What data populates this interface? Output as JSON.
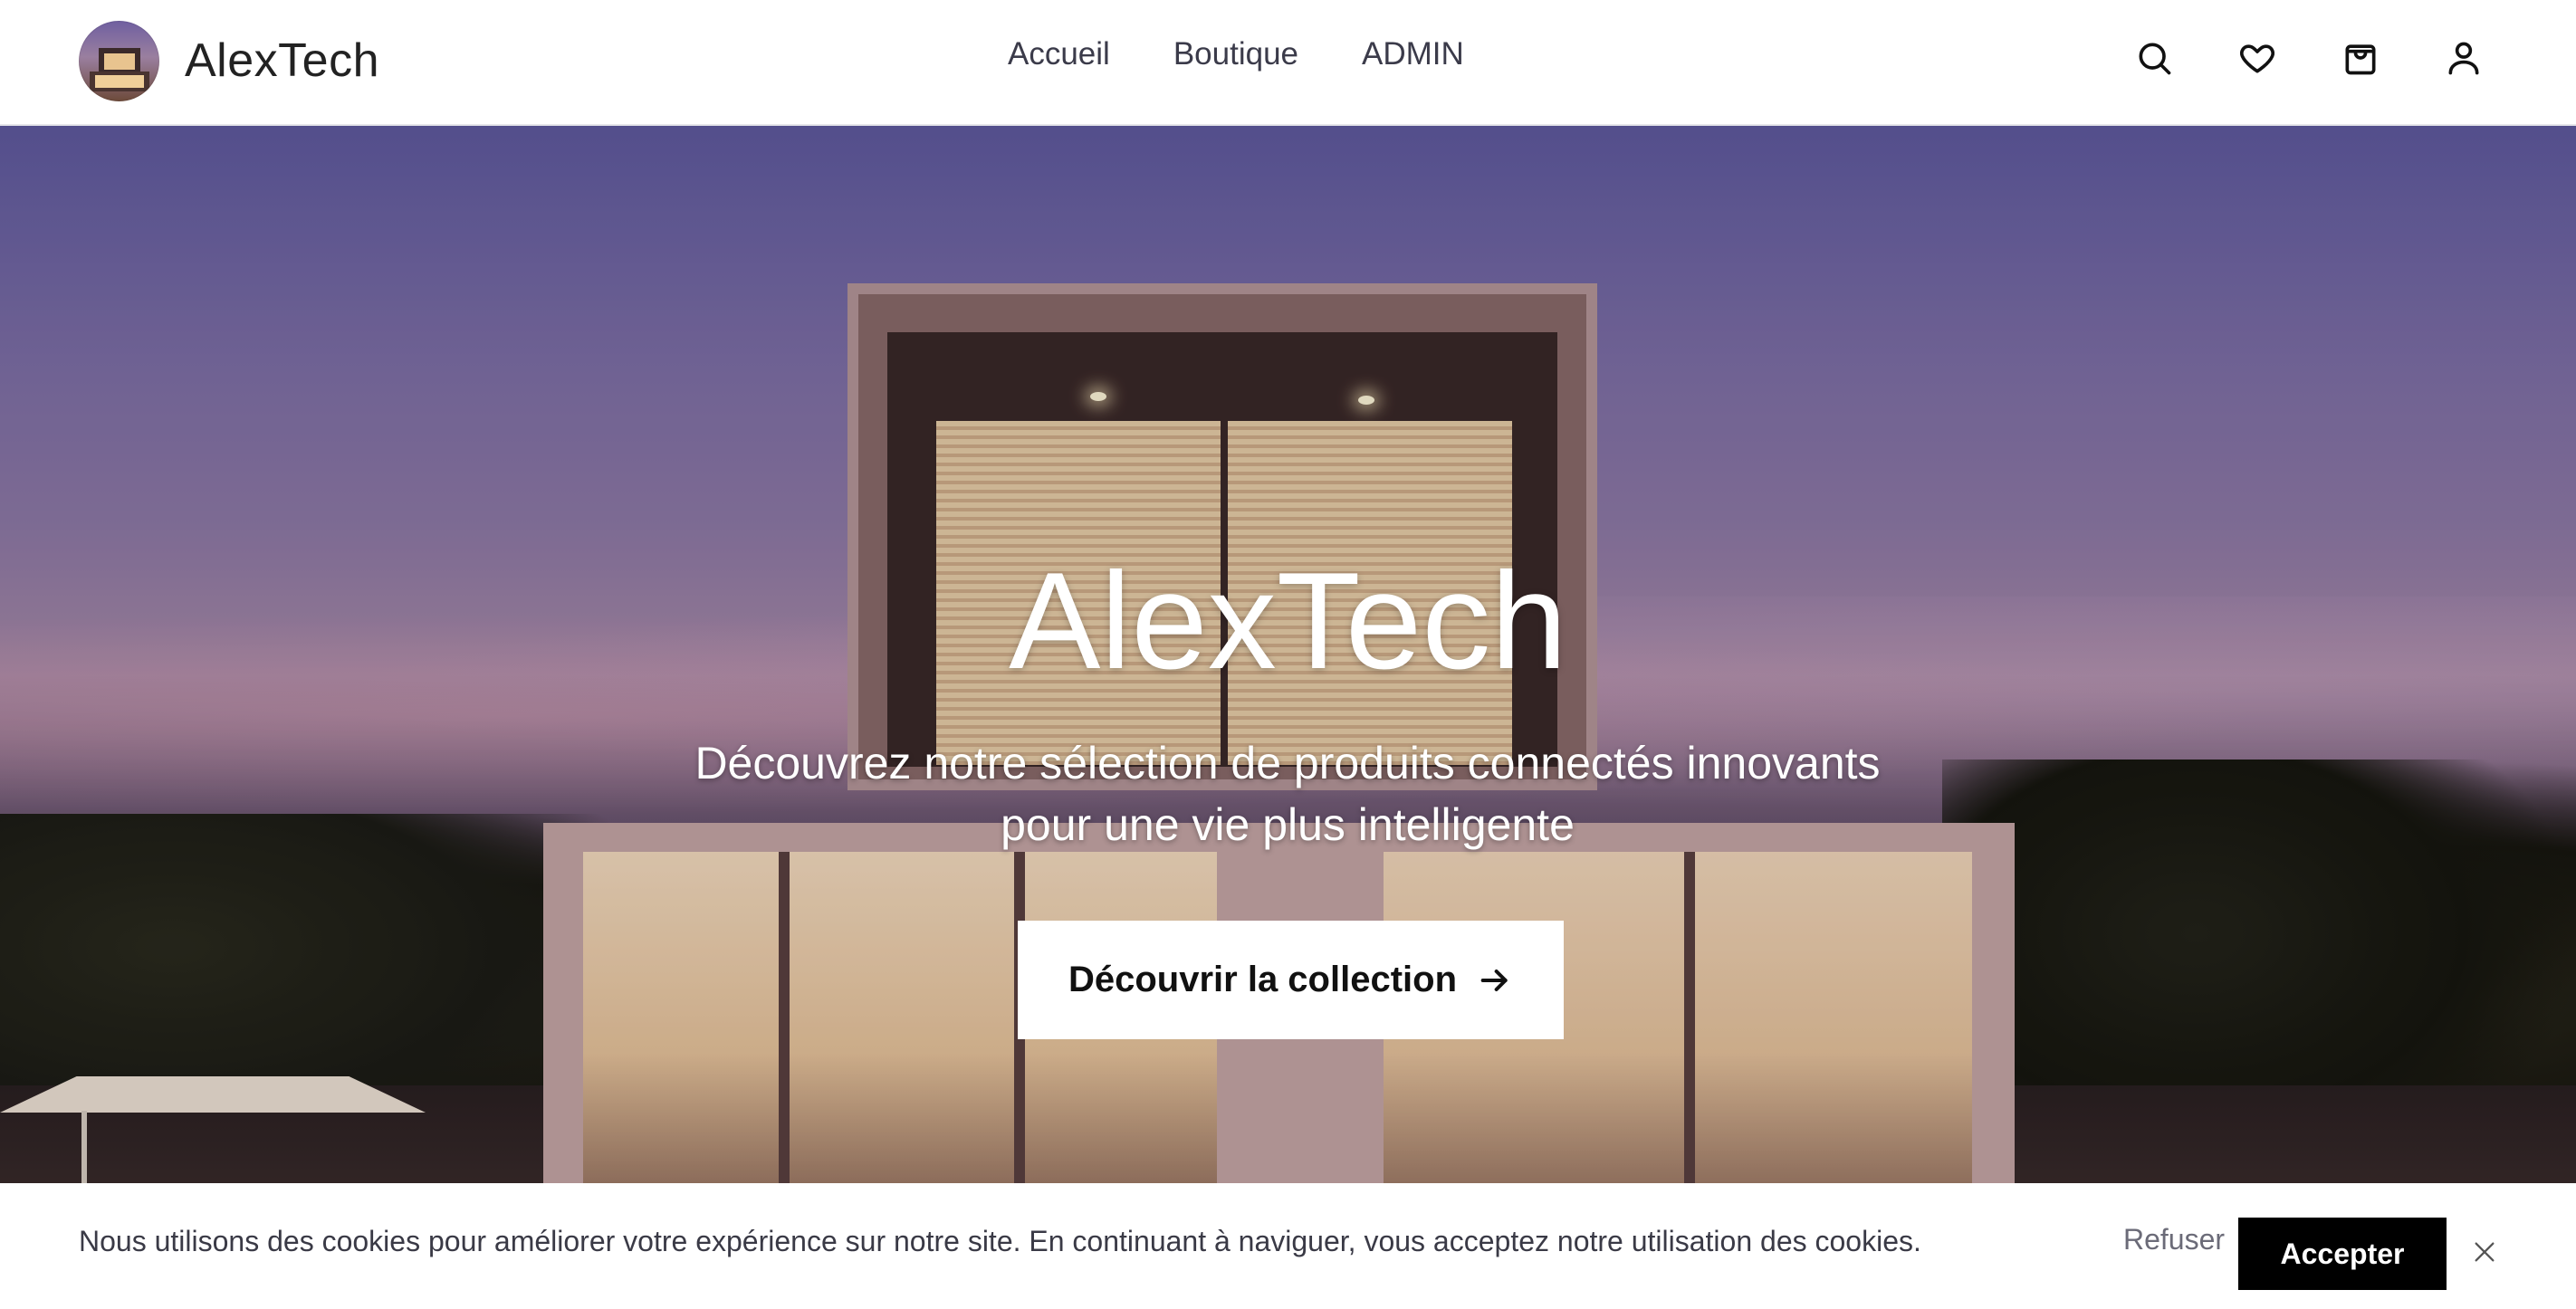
{
  "header": {
    "brand_name": "AlexTech",
    "nav": [
      {
        "label": "Accueil"
      },
      {
        "label": "Boutique"
      },
      {
        "label": "ADMIN"
      }
    ],
    "icons": [
      "search-icon",
      "heart-icon",
      "shopping-bag-icon",
      "user-icon"
    ]
  },
  "hero": {
    "title": "AlexTech",
    "subtitle_line1": "Découvrez notre sélection de produits connectés innovants",
    "subtitle_line2": "pour une vie plus intelligente",
    "cta_label": "Découvrir la collection",
    "cta_icon": "arrow-right-icon"
  },
  "cookie": {
    "message": "Nous utilisons des cookies pour améliorer votre expérience sur notre site. En continuant à naviguer, vous acceptez notre utilisation des cookies.",
    "refuse_label": "Refuser",
    "accept_label": "Accepter",
    "close_icon": "close-icon"
  },
  "colors": {
    "accent_button_bg": "#000000",
    "header_bg": "#ffffff",
    "nav_text": "#3b3b4a"
  }
}
